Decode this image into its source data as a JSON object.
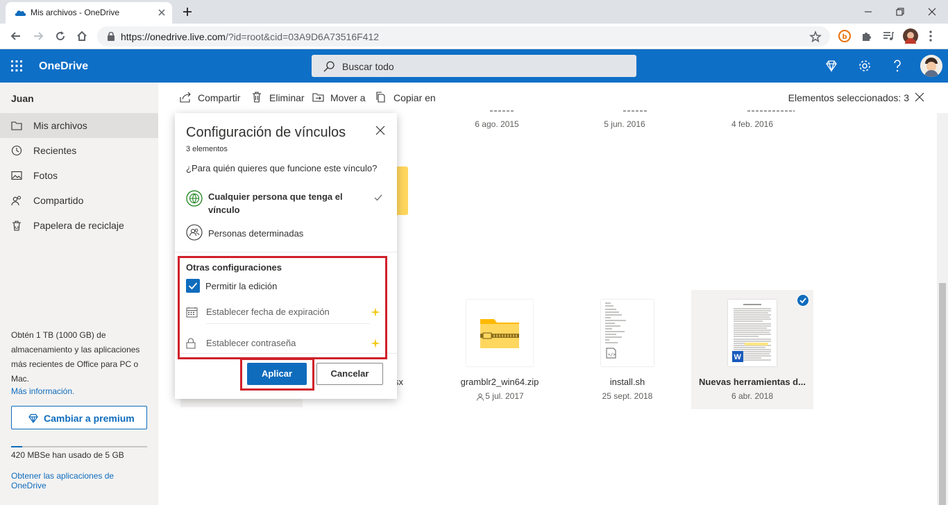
{
  "browser": {
    "tab_title": "Mis archivos - OneDrive",
    "url_host": "https://onedrive.live.com",
    "url_rest": "/?id=root&cid=03A9D6A73516F412"
  },
  "header": {
    "brand": "OneDrive",
    "search_placeholder": "Buscar todo"
  },
  "sidebar": {
    "user": "Juan",
    "items": [
      {
        "label": "Mis archivos",
        "icon": "folder-icon"
      },
      {
        "label": "Recientes",
        "icon": "clock-icon"
      },
      {
        "label": "Fotos",
        "icon": "photo-icon"
      },
      {
        "label": "Compartido",
        "icon": "people-icon"
      },
      {
        "label": "Papelera de reciclaje",
        "icon": "trash-icon"
      }
    ],
    "promo": "Obtén 1 TB (1000 GB) de almacenamiento y las aplicaciones más recientes de Office para PC o Mac.",
    "more_info": "Más información.",
    "premium_button": "Cambiar a premium",
    "storage_used_fraction": 0.084,
    "storage_text": "420 MBSe han usado de 5 GB",
    "get_apps": "Obtener las aplicaciones de OneDrive"
  },
  "commands": {
    "share": "Compartir",
    "delete": "Eliminar",
    "move": "Mover a",
    "copy": "Copiar en",
    "selected": "Elementos seleccionados: 3"
  },
  "files": {
    "top_row_dates": [
      "6 ago. 2015",
      "5 jun. 2016",
      "4 feb. 2016"
    ],
    "bottom_row": [
      {
        "name": "gramblr2_win64.zip",
        "date": "5 jul. 2017",
        "shared": true
      },
      {
        "name": "install.sh",
        "date": "25 sept. 2018",
        "shared": false
      },
      {
        "name": "Nuevas herramientas d...",
        "date": "6 abr. 2018",
        "shared": false,
        "selected": true
      }
    ],
    "partial_name": "sx"
  },
  "dialog": {
    "title": "Configuración de vínculos",
    "count": "3 elementos",
    "question": "¿Para quién quieres que funcione este vínculo?",
    "option_anyone": "Cualquier persona que tenga el vínculo",
    "option_specific": "Personas determinadas",
    "other_settings": "Otras configuraciones",
    "allow_edit": "Permitir la edición",
    "allow_edit_checked": true,
    "expiration_placeholder": "Establecer fecha de expiración",
    "password_placeholder": "Establecer contraseña",
    "apply": "Aplicar",
    "cancel": "Cancelar"
  },
  "colors": {
    "header_blue": "#0e6fc7",
    "accent": "#0f6cbd",
    "annotation_red": "#d0202a",
    "premium_star": "#f2c811"
  }
}
